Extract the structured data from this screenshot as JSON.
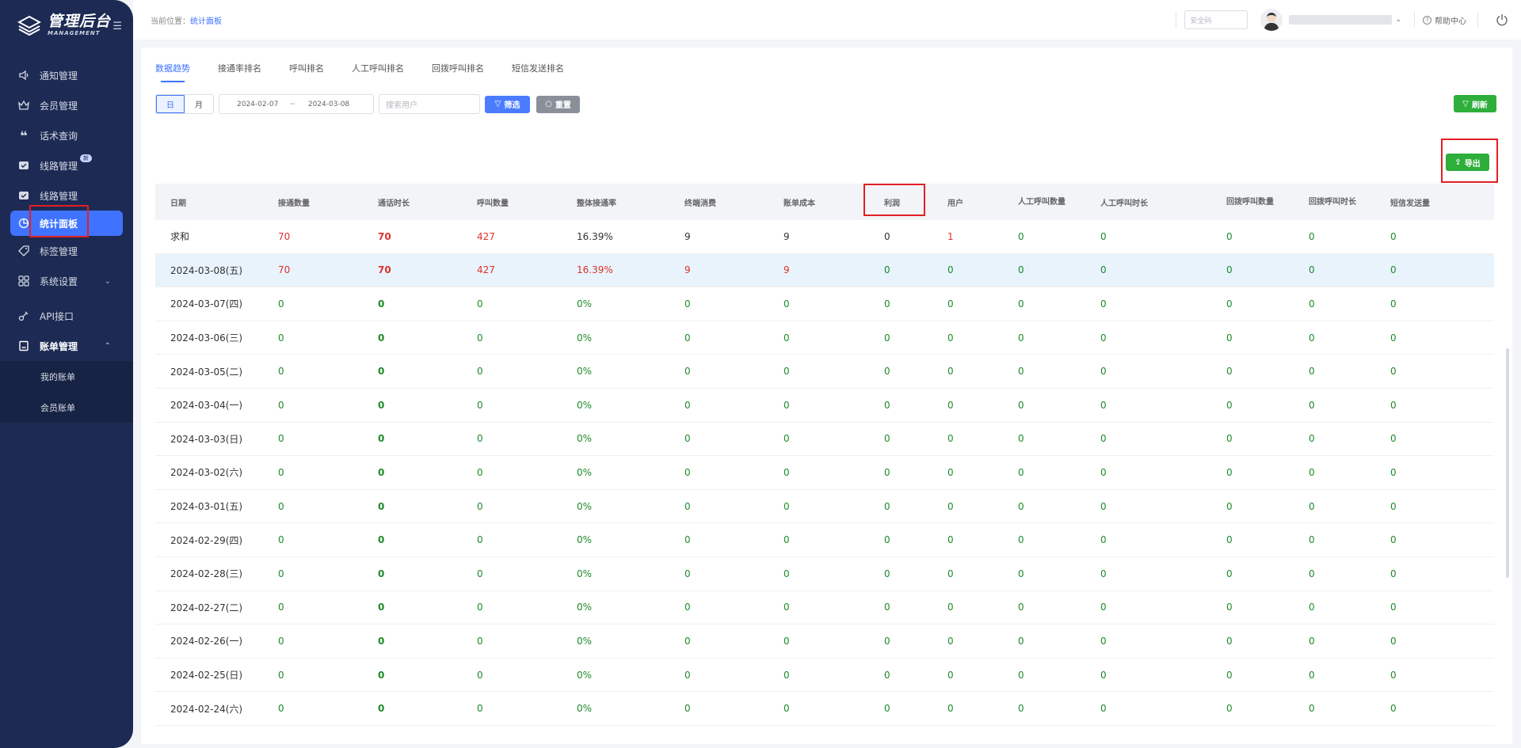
{
  "app": {
    "title": "管理后台",
    "subtitle": "MANAGEMENT"
  },
  "sidebar": {
    "items": [
      {
        "label": "通知管理",
        "icon": "speaker-icon"
      },
      {
        "label": "会员管理",
        "icon": "crown-icon"
      },
      {
        "label": "话术查询",
        "icon": "quote-icon"
      },
      {
        "label": "线路管理",
        "icon": "line-icon",
        "badge": "新"
      },
      {
        "label": "线路管理",
        "icon": "line-icon"
      },
      {
        "label": "统计面板",
        "icon": "pie-chart-icon",
        "active": true
      },
      {
        "label": "标签管理",
        "icon": "tag-icon"
      },
      {
        "label": "系统设置",
        "icon": "grid-icon"
      },
      {
        "label": "API接口",
        "icon": "api-icon"
      },
      {
        "label": "账单管理",
        "icon": "bill-icon"
      }
    ],
    "submenu": [
      "我的账单",
      "会员账单"
    ]
  },
  "topbar": {
    "crumb_prefix": "当前位置：",
    "crumb_current": "统计面板",
    "security_placeholder": "安全码",
    "help_label": "帮助中心"
  },
  "tabs": [
    "数据趋势",
    "接通率排名",
    "呼叫排名",
    "人工呼叫排名",
    "回拨呼叫排名",
    "短信发送排名"
  ],
  "filters": {
    "day": "日",
    "month": "月",
    "start_date": "2024-02-07",
    "end_date": "2024-03-08",
    "date_sep": "~",
    "search_placeholder": "搜索用户",
    "filter_label": "筛选",
    "reset_label": "重置",
    "refresh_label": "刷新",
    "export_label": "导出"
  },
  "table": {
    "headers": [
      "日期",
      "接通数量",
      "通话时长",
      "呼叫数量",
      "整体接通率",
      "终端消费",
      "账单成本",
      "利润",
      "用户",
      "人工呼叫数量",
      "人工呼叫时长",
      "回拨呼叫数量",
      "回拨呼叫时长",
      "短信发送量"
    ],
    "rows": [
      [
        "求和",
        "70",
        "70",
        "427",
        "16.39%",
        "9",
        "9",
        "0",
        "1",
        "0",
        "0",
        "0",
        "0",
        "0"
      ],
      [
        "2024-03-08(五)",
        "70",
        "70",
        "427",
        "16.39%",
        "9",
        "9",
        "0",
        "0",
        "0",
        "0",
        "0",
        "0",
        "0"
      ],
      [
        "2024-03-07(四)",
        "0",
        "0",
        "0",
        "0%",
        "0",
        "0",
        "0",
        "0",
        "0",
        "0",
        "0",
        "0",
        "0"
      ],
      [
        "2024-03-06(三)",
        "0",
        "0",
        "0",
        "0%",
        "0",
        "0",
        "0",
        "0",
        "0",
        "0",
        "0",
        "0",
        "0"
      ],
      [
        "2024-03-05(二)",
        "0",
        "0",
        "0",
        "0%",
        "0",
        "0",
        "0",
        "0",
        "0",
        "0",
        "0",
        "0",
        "0"
      ],
      [
        "2024-03-04(一)",
        "0",
        "0",
        "0",
        "0%",
        "0",
        "0",
        "0",
        "0",
        "0",
        "0",
        "0",
        "0",
        "0"
      ],
      [
        "2024-03-03(日)",
        "0",
        "0",
        "0",
        "0%",
        "0",
        "0",
        "0",
        "0",
        "0",
        "0",
        "0",
        "0",
        "0"
      ],
      [
        "2024-03-02(六)",
        "0",
        "0",
        "0",
        "0%",
        "0",
        "0",
        "0",
        "0",
        "0",
        "0",
        "0",
        "0",
        "0"
      ],
      [
        "2024-03-01(五)",
        "0",
        "0",
        "0",
        "0%",
        "0",
        "0",
        "0",
        "0",
        "0",
        "0",
        "0",
        "0",
        "0"
      ],
      [
        "2024-02-29(四)",
        "0",
        "0",
        "0",
        "0%",
        "0",
        "0",
        "0",
        "0",
        "0",
        "0",
        "0",
        "0",
        "0"
      ],
      [
        "2024-02-28(三)",
        "0",
        "0",
        "0",
        "0%",
        "0",
        "0",
        "0",
        "0",
        "0",
        "0",
        "0",
        "0",
        "0"
      ],
      [
        "2024-02-27(二)",
        "0",
        "0",
        "0",
        "0%",
        "0",
        "0",
        "0",
        "0",
        "0",
        "0",
        "0",
        "0",
        "0"
      ],
      [
        "2024-02-26(一)",
        "0",
        "0",
        "0",
        "0%",
        "0",
        "0",
        "0",
        "0",
        "0",
        "0",
        "0",
        "0",
        "0"
      ],
      [
        "2024-02-25(日)",
        "0",
        "0",
        "0",
        "0%",
        "0",
        "0",
        "0",
        "0",
        "0",
        "0",
        "0",
        "0",
        "0"
      ],
      [
        "2024-02-24(六)",
        "0",
        "0",
        "0",
        "0%",
        "0",
        "0",
        "0",
        "0",
        "0",
        "0",
        "0",
        "0",
        "0"
      ]
    ]
  },
  "colors": {
    "accent": "#3f73ff",
    "sidebar": "#1d2b54",
    "success": "#2eae3a",
    "danger": "#e0322a",
    "highlight": "#e31e24"
  }
}
